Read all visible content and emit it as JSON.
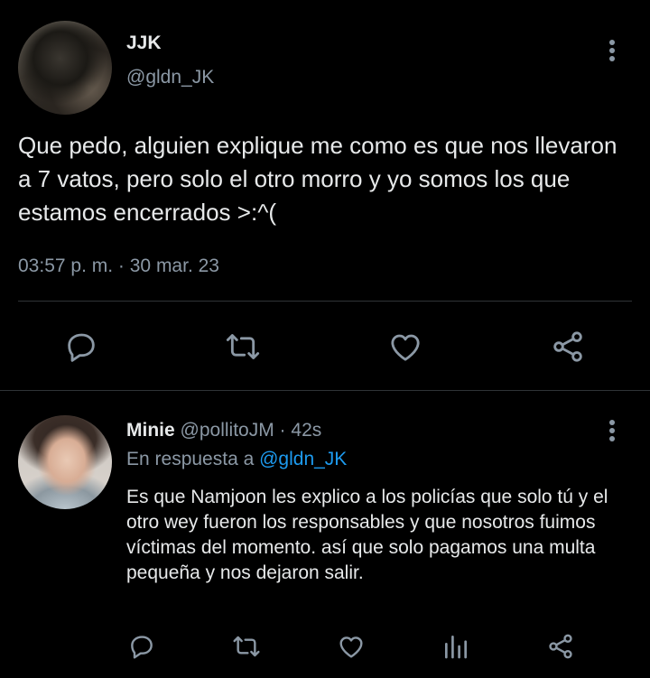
{
  "main_tweet": {
    "author_name": "JJK",
    "author_handle": "@gldn_JK",
    "text": "Que pedo, alguien explique me como es que nos llevaron a 7 vatos, pero solo el otro morro y yo somos los que estamos encerrados >:^(",
    "time": "03:57 p. m.",
    "separator": "·",
    "date": "30 mar. 23"
  },
  "reply": {
    "author_name": "Minie",
    "author_handle": "@pollitoJM",
    "separator": "·",
    "age": "42s",
    "in_reply_prefix": "En respuesta a",
    "in_reply_to": "@gldn_JK",
    "text": "Es que Namjoon les explico a los policías que solo tú y el otro wey fueron los responsables y que nosotros fuimos víctimas del momento. así que solo pagamos una multa pequeña y nos dejaron salir."
  },
  "icons": {
    "reply": "speech-bubble-icon",
    "retweet": "retweet-icon",
    "like": "heart-icon",
    "share": "share-icon",
    "stats": "bar-chart-icon",
    "more": "more-vertical-icon"
  },
  "colors": {
    "background": "#000000",
    "text": "#e7e9ea",
    "secondary": "#8b98a5",
    "link": "#1d9bf0",
    "divider": "#2f3336"
  }
}
